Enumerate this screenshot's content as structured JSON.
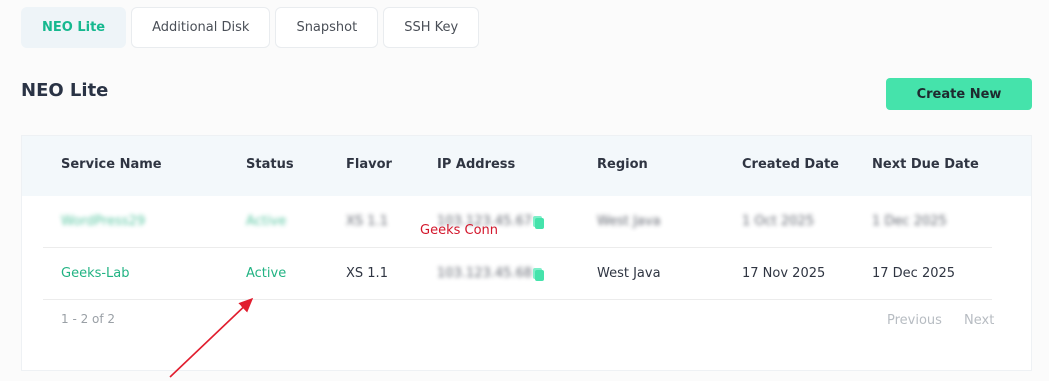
{
  "tabs": [
    {
      "label": "NEO Lite",
      "active": true
    },
    {
      "label": "Additional Disk",
      "active": false
    },
    {
      "label": "Snapshot",
      "active": false
    },
    {
      "label": "SSH Key",
      "active": false
    }
  ],
  "page_title": "NEO Lite",
  "create_button": "Create New",
  "table": {
    "columns": [
      "Service Name",
      "Status",
      "Flavor",
      "IP Address",
      "Region",
      "Created Date",
      "Next Due Date"
    ],
    "rows": [
      {
        "service_name": "WordPress29",
        "status": "Active",
        "flavor": "XS 1.1",
        "ip_address": "103.123.45.67",
        "region": "West Java",
        "created_date": "1 Oct 2025",
        "next_due_date": "1 Dec 2025"
      },
      {
        "service_name": "Geeks-Lab",
        "status": "Active",
        "flavor": "XS 1.1",
        "ip_address": "103.123.45.68",
        "region": "West Java",
        "created_date": "17 Nov 2025",
        "next_due_date": "17 Dec 2025"
      }
    ]
  },
  "pagination": {
    "count": "1 - 2 of 2",
    "previous": "Previous",
    "next": "Next"
  },
  "annotation": {
    "text": "Geeks Conn",
    "color": "#d3162b"
  },
  "colors": {
    "accent": "#45e3ab",
    "active_tab_text": "#16b88f",
    "service_link": "#22b383"
  }
}
